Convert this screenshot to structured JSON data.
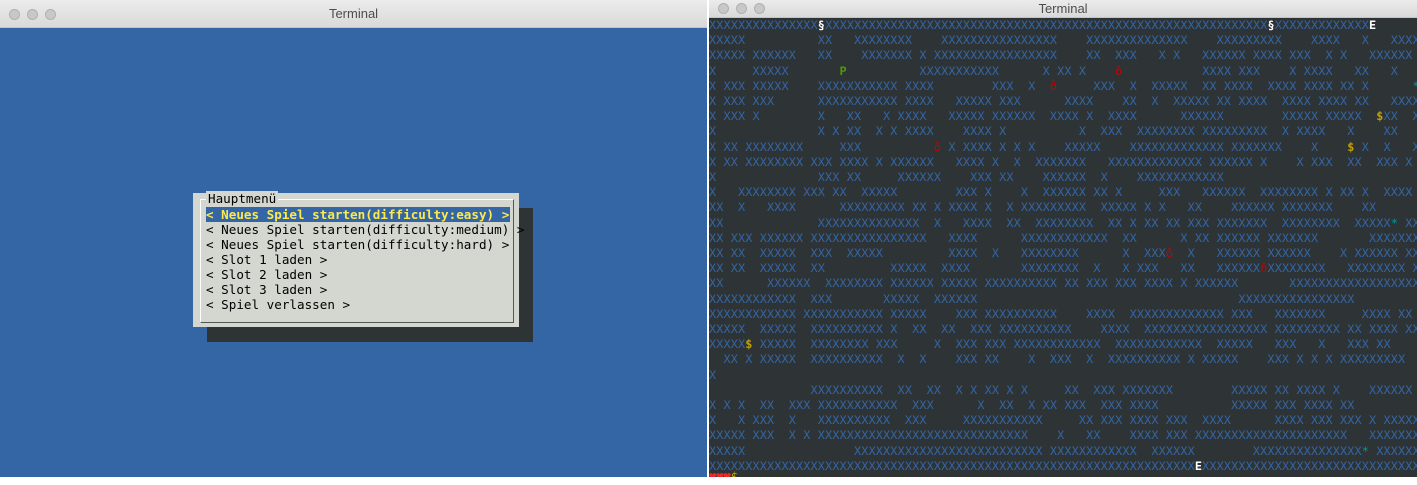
{
  "left_window": {
    "title": "Terminal",
    "dialog": {
      "title": "Hauptmenü",
      "items": [
        "< Neues Spiel starten(difficulty:easy) >",
        "< Neues Spiel starten(difficulty:medium) >",
        "< Neues Spiel starten(difficulty:hard) >",
        "< Slot 1 laden >",
        "< Slot 2 laden >",
        "< Slot 3 laden >",
        "< Spiel verlassen >"
      ],
      "selected_index": 0
    }
  },
  "right_window": {
    "title": "Terminal",
    "maze_rows": [
      "XXXXXXXXXXXXXXX§XXXXXXXXXXXXXXXXXXXXXXXXXXXXXXXXXXXXXXXXXXXXXXXXXXXXXXXXXXXXX§XXXXXXXXXXXXXE",
      "XXXXX          XX   XXXXXXXX    XXXXXXXXXXXXXXXX    XXXXXXXXXXXXXX    XXXXXXXXX    XXXX   X   XXXXXX  X",
      "XXXXX XXXXXX   XX    XXXXXXX X XXXXXXXXXXXXXXXXX    XX  XXX   X X   XXXXXX XXXX XXX  X X   XXXXXX  XX",
      "X     XXXXX       P          XXXXXXXXXXX      X XX X    ô           XXXX XXX    X XXXX   XX   X",
      "X XXX XXXXX    XXXXXXXXXXX XXXX        XXX  X  ô     XXX  X  XXXXX  XX XXXX  XXXX XXXX XX X      *X",
      "X XXX XXX      XXXXXXXXXXX XXXX   XXXXX XXX      XXXX    XX  X  XXXXX XX XXXX  XXXX XXXX XX   XXXXX XX",
      "X XXX X        X   XX   X XXXX   XXXXX XXXXXX  XXXX X  XXXX      XXXXXX        XXXXX XXXXX  $XX  X",
      "X              X X XX  X X XXXX    XXXX X          X  XXX  XXXXXXXX XXXXXXXXX  X XXXX   X    XX",
      "X XX XXXXXXXX     XXX          ô X XXXX X X X    XXXXX    XXXXXXXXXXXXX XXXXXXX    X    $ X  X   XXX",
      "X XX XXXXXXXX XXX XXXX X XXXXXX   XXXX X  X  XXXXXXX   XXXXXXXXXXXXX XXXXXX X    X XXX  XX  XXX X",
      "X              XXX XX     XXXXXX    XXX XX    XXXXXX  X    XXXXXXXXXXXX",
      "X   XXXXXXXX XXX XX  XXXXX        XXX X    X  XXXXXX XX X     XXX   XXXXXX  XXXXXXXX X XX X  XXXX",
      "XX  X   XXXX      XXXXXXXXX XX X XXXX X  X XXXXXXXXX  XXXXX X X   XX    XXXXXX XXXXXXX    XX",
      "XX             XXXXXXXXXXXXXX  X   XXXX  XX  XXXXXXXX  XX X XX XX XXX XXXXXXX  XXXXXXXX  XXXXX* XXX XXX",
      "XX XXX XXXXXX XXXXXXXXXXXXXXXX   XXXX      XXXXXXXXXXXX  XX      X XX XXXXXX XXXXXXX       XXXXXXX XXX",
      "XX XX  XXXXX  XXX  XXXXX         XXXX  X   XXXXXXXX      X  XXXô  X   XXXXXX XXXXXX    X XXXXXX XXX",
      "XX XX  XXXXX  XX         XXXXX  XXXX       XXXXXXXX  X   X XXX   XX   XXXXXXôXXXXXXXX   XXXXXXXX XXX",
      "XX      XXXXXX  XXXXXXXX XXXXXX XXXXX XXXXXXXXXX XX XXX XXX XXXX X XXXXXX       XXXXXXXXXXXXXXXXXX XX",
      "XXXXXXXXXXXX  XXX       XXXXX  XXXXXX                                    XXXXXXXXXXXXXXXX",
      "XXXXXXXXXXXX XXXXXXXXXXX XXXXX    XXX XXXXXXXXXX    XXXX  XXXXXXXXXXXXX XXX   XXXXXXX     XXXX XX",
      "XXXXX  XXXXX  XXXXXXXXXX X  XX  XX  XXX XXXXXXXXXX    XXXX  XXXXXXXXXXXXXXXXX XXXXXXXXX XX XXXX XX",
      "XXXXX$ XXXXX  XXXXXXXX XXX     X  XXX XXX XXXXXXXXXXXX  XXXXXXXXXXXX  XXXXX   XXX   X   XXX XX",
      "  XX X XXXXX  XXXXXXXXXX  X  X    XXX XX    X  XXX  X  XXXXXXXXXX X XXXXX    XXX X X X XXXXXXXXX  X",
      "X",
      "              XXXXXXXXXX  XX  XX  X X XX X X     XX  XXX XXXXXXX        XXXXX XX XXXX X    XXXXXX X XXX",
      "X X X  XX  XXX XXXXXXXXXXX  XXX      X  XX  X XX XXX  XXX XXXX          XXXXX XXX XXXX XX",
      "X   X XXX  X   XXXXXXXXXX  XXX     XXXXXXXXXXX     XX XXX XXXX XXX  XXXX      XXXX XXX XXX X XXXXXX",
      "XXXXX XXX  X X XXXXXXXXXXXXXXXXXXXXXXXXXXXXX    X   XX    XXXX XXX XXXXXXXXXXXXXXXXXXXXX   XXXXXXXX",
      "XXXXX               XXXXXXXXXXXXXXXXXXXXXXXXXX XXXXXXXXXXXX  XXXXXX        XXXXXXXXXXXXXXX* XXXXXXXXXXX",
      "XXXXXXXXXXXXXXXXXXXXXXXXXXXXXXXXXXXXXXXXXXXXXXXXXXXXXXXXXXXXXXXXXXXEXXXXXXXXXXXXXXXXXXXXXXXXXXXXXXXXX"
    ],
    "status": {
      "hearts": "♥♥♥",
      "money_symbol": "$"
    }
  },
  "colors": {
    "desktop_blue": "#3465a4",
    "terminal_dark": "#2e3436",
    "dialog_gray": "#d3d7cf",
    "selected_text": "#fce94f",
    "wall": "#3465a4",
    "player": "#4e9a06",
    "enemy": "#cc0000",
    "coin": "#c4a000",
    "exit": "#ffffff",
    "item": "#06989a"
  }
}
